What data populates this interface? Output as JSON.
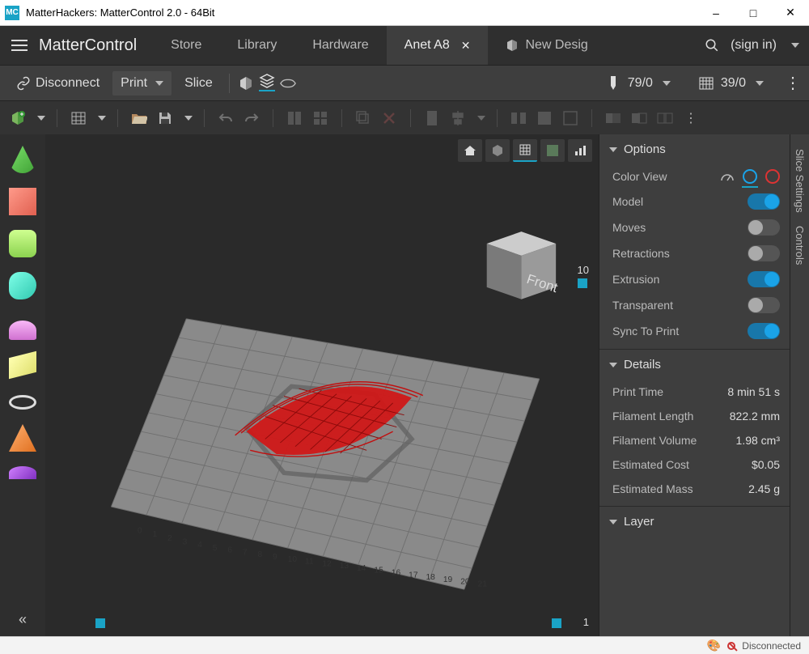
{
  "window": {
    "app_badge": "MC",
    "title": "MatterHackers: MatterControl 2.0 - 64Bit"
  },
  "menubar": {
    "app_name": "MatterControl",
    "tabs": [
      {
        "label": "Store"
      },
      {
        "label": "Library"
      },
      {
        "label": "Hardware"
      },
      {
        "label": "Anet A8",
        "active": true,
        "closable": true
      },
      {
        "label": "New Desig",
        "has_icon": true
      }
    ],
    "signin": "(sign in)"
  },
  "actionbar": {
    "disconnect": "Disconnect",
    "print": "Print",
    "slice": "Slice",
    "temp_nozzle": "79/0",
    "temp_bed": "39/0"
  },
  "viewport": {
    "cube_face": "Front",
    "layer_max": "10",
    "layer_min": "1"
  },
  "options_panel": {
    "header": "Options",
    "color_view_label": "Color View",
    "rows": [
      {
        "label": "Model",
        "on": true
      },
      {
        "label": "Moves",
        "on": false
      },
      {
        "label": "Retractions",
        "on": false
      },
      {
        "label": "Extrusion",
        "on": true
      },
      {
        "label": "Transparent",
        "on": false
      },
      {
        "label": "Sync To Print",
        "on": true
      }
    ]
  },
  "details_panel": {
    "header": "Details",
    "rows": [
      {
        "label": "Print Time",
        "value": "8 min 51 s"
      },
      {
        "label": "Filament Length",
        "value": "822.2 mm"
      },
      {
        "label": "Filament Volume",
        "value": "1.98 cm³"
      },
      {
        "label": "Estimated Cost",
        "value": "$0.05"
      },
      {
        "label": "Estimated Mass",
        "value": "2.45 g"
      }
    ]
  },
  "layer_panel": {
    "header": "Layer"
  },
  "vtabs": {
    "slice": "Slice Settings",
    "controls": "Controls"
  },
  "statusbar": {
    "status": "Disconnected"
  }
}
